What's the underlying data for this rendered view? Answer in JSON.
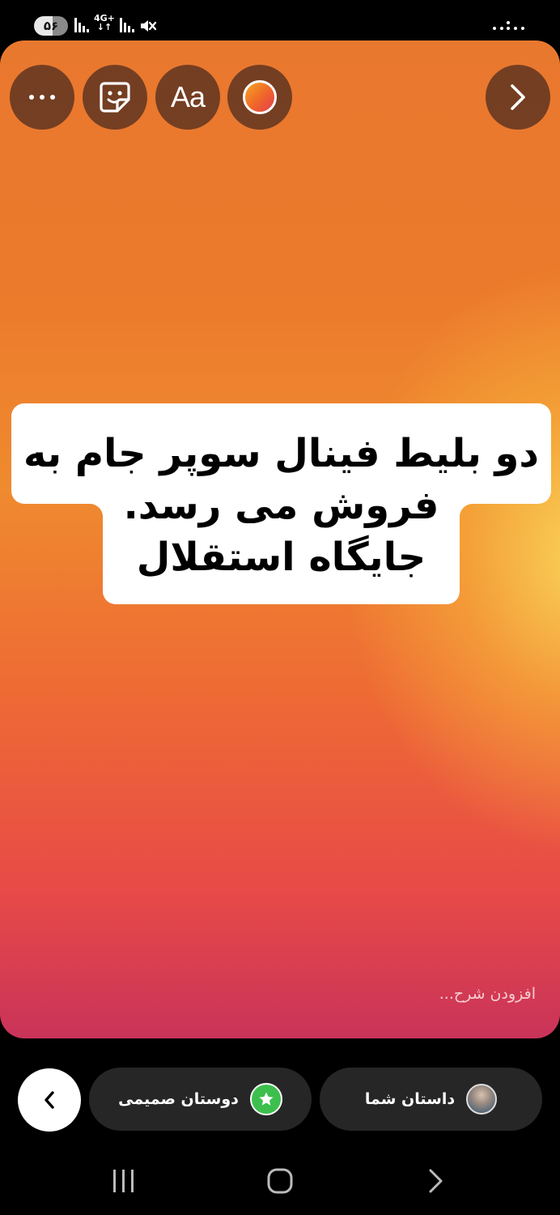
{
  "status_bar": {
    "battery_level": "۵۶",
    "network_type": "4G+"
  },
  "story_editor": {
    "text_tool_label": "Aa",
    "story_text": [
      "دو بلیط فینال سوپر جام به",
      "فروش می رسد.",
      "جایگاه استقلال"
    ],
    "caption_placeholder": "افزودن شرح..."
  },
  "share_bar": {
    "close_friends_label": "دوستان صمیمی",
    "your_story_label": "داستان شما"
  },
  "colors": {
    "story_gradient_top": "#e9782f",
    "story_gradient_bottom": "#c93359",
    "close_friends_green": "#3dbf4e",
    "pill_background": "#262626"
  }
}
